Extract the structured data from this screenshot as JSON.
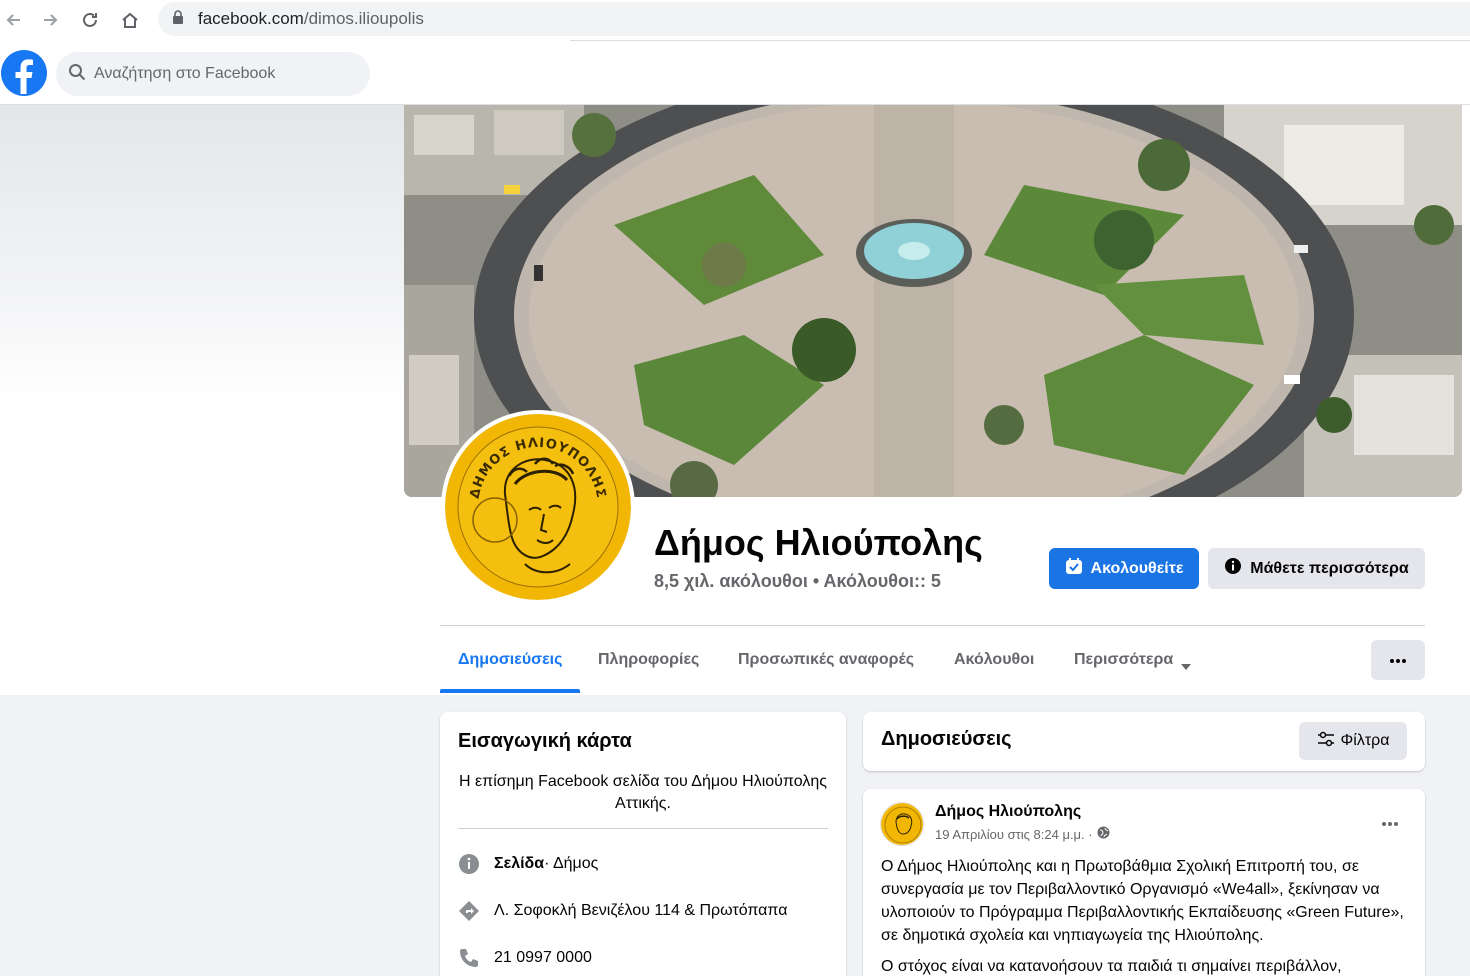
{
  "browser": {
    "url_domain": "facebook.com",
    "url_path": "/dimos.ilioupolis"
  },
  "header": {
    "search_placeholder": "Αναζήτηση στο Facebook"
  },
  "profile": {
    "name": "Δήμος Ηλιούπολης",
    "stats": "8,5 χιλ. ακόλουθοι • Ακόλουθοι:: 5",
    "follow_label": "Ακολουθείτε",
    "learn_more_label": "Μάθετε περισσότερα",
    "avatar_text": "ΔΗΜΟΣ ΗΛΙΟΥΠΟΛΗΣ"
  },
  "tabs": [
    {
      "label": "Δημοσιεύσεις",
      "active": true
    },
    {
      "label": "Πληροφορίες",
      "active": false
    },
    {
      "label": "Προσωπικές αναφορές",
      "active": false
    },
    {
      "label": "Ακόλουθοι",
      "active": false
    },
    {
      "label": "Περισσότερα",
      "active": false
    }
  ],
  "intro": {
    "title": "Εισαγωγική κάρτα",
    "description": "Η επίσημη Facebook σελίδα του Δήμου Ηλιούπολης Αττικής.",
    "category_bold": "Σελίδα",
    "category_rest": " · Δήμος",
    "address": "Λ. Σοφοκλή Βενιζέλου 114 & Πρωτόπαπα",
    "phone": "21 0997 0000"
  },
  "posts": {
    "title": "Δημοσιεύσεις",
    "filter_label": "Φίλτρα",
    "post": {
      "author": "Δήμος Ηλιούπολης",
      "time": "19 Απριλίου στις 8:24 μ.μ. ·",
      "text": "Ο Δήμος Ηλιούπολης και η Πρωτοβάθμια Σχολική Επιτροπή του, σε συνεργασία με τον Περιβαλλοντικό Οργανισμό «We4all», ξεκίνησαν να υλοποιούν το Πρόγραμμα Περιβαλλοντικής Εκπαίδευσης «Green Future», σε δημοτικά σχολεία και νηπιαγωγεία της Ηλιούπολης.",
      "text2": "Ο στόχος είναι να κατανοήσουν τα παιδιά τι σημαίνει περιβάλλον,"
    }
  },
  "colors": {
    "fb_blue": "#1877f2",
    "follow_blue": "#1b74e4",
    "secondary_text": "#65676b",
    "button_gray": "#e4e6eb",
    "coin_gold": "#f2b705"
  }
}
